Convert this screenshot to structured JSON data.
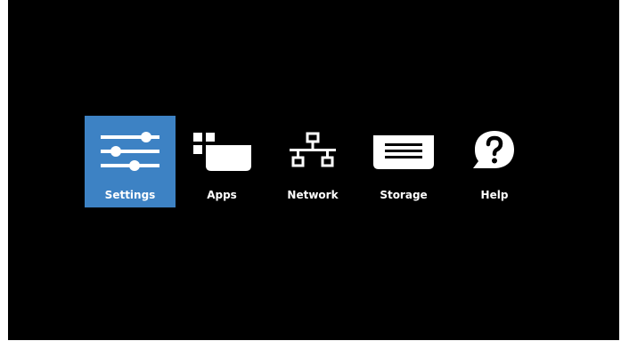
{
  "menu": {
    "items": [
      {
        "label": "Settings",
        "icon": "settings-sliders-icon",
        "selected": true
      },
      {
        "label": "Apps",
        "icon": "apps-icon",
        "selected": false
      },
      {
        "label": "Network",
        "icon": "network-icon",
        "selected": false
      },
      {
        "label": "Storage",
        "icon": "storage-icon",
        "selected": false
      },
      {
        "label": "Help",
        "icon": "help-icon",
        "selected": false
      }
    ]
  },
  "colors": {
    "background": "#000000",
    "selected_tile": "#3d82c4",
    "foreground": "#ffffff"
  }
}
